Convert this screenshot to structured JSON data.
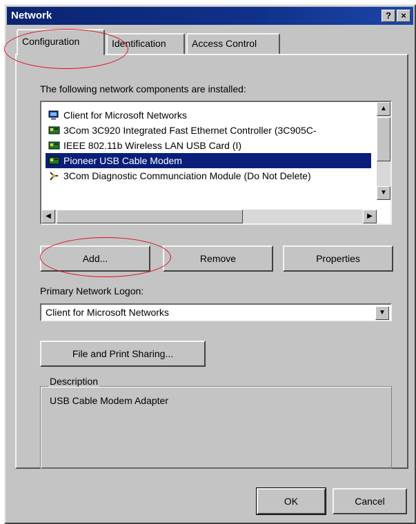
{
  "window": {
    "title": "Network",
    "help_label": "?",
    "close_label": "×"
  },
  "tabs": [
    {
      "label": "Configuration",
      "active": true
    },
    {
      "label": "Identification",
      "active": false
    },
    {
      "label": "Access Control",
      "active": false
    }
  ],
  "components": {
    "header": "The following network components are installed:",
    "items": [
      {
        "label": "Client for Microsoft Networks",
        "icon": "network-client-icon",
        "selected": false
      },
      {
        "label": "3Com 3C920 Integrated Fast Ethernet Controller (3C905C-",
        "icon": "network-adapter-icon",
        "selected": false
      },
      {
        "label": "IEEE 802.11b Wireless LAN USB Card (I)",
        "icon": "network-adapter-icon",
        "selected": false
      },
      {
        "label": "Pioneer USB Cable Modem",
        "icon": "network-adapter-icon",
        "selected": true
      },
      {
        "label": "3Com Diagnostic Communciation Module (Do Not Delete)",
        "icon": "protocol-icon",
        "selected": false
      }
    ]
  },
  "buttons": {
    "add": "Add...",
    "remove": "Remove",
    "properties": "Properties",
    "file_print": "File and Print Sharing...",
    "ok": "OK",
    "cancel": "Cancel"
  },
  "logon": {
    "label": "Primary Network Logon:",
    "value": "Client for Microsoft Networks"
  },
  "description": {
    "legend": "Description",
    "text": "USB Cable Modem Adapter"
  },
  "colors": {
    "highlight": "#0a1f7a",
    "title_bar": "#0a2470",
    "annotation": "#e0101a"
  }
}
